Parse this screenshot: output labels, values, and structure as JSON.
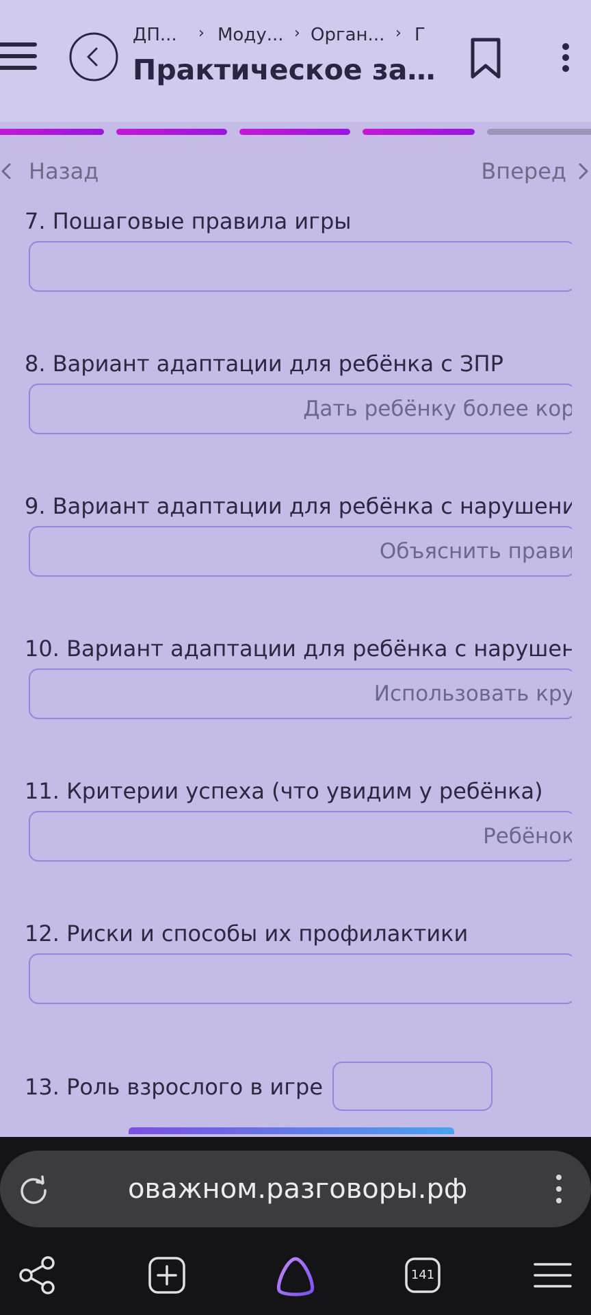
{
  "header": {
    "breadcrumb": [
      "ДП...",
      "Моду...",
      "Орган...",
      "Г"
    ],
    "title": "Практическое задн..."
  },
  "progress": {
    "segments": [
      "done",
      "done",
      "done",
      "done",
      "todo"
    ]
  },
  "nav": {
    "back_label": "Назад",
    "next_label": "Вперед"
  },
  "form": {
    "questions": [
      {
        "label": "7. Пошаговые правила игры",
        "value": ""
      },
      {
        "label": "8. Вариант адаптации для ребёнка с ЗПР",
        "value": "Дать ребёнку более кор"
      },
      {
        "label": "9. Вариант адаптации для ребёнка с нарушени",
        "value": "Объяснить прави"
      },
      {
        "label": "10. Вариант адаптации для ребёнка с нарушен",
        "value": "Использовать кру"
      },
      {
        "label": "11. Критерии успеха (что увидим у ребёнка)",
        "value": "Ребёнок"
      },
      {
        "label": "12. Риски и способы их профилактики",
        "value": ""
      }
    ],
    "q13_label": "13. Роль взрослого в игре",
    "q13_value": ""
  },
  "browser": {
    "url": "оважном.разговоры.рф",
    "tabs_count": "141"
  },
  "colors": {
    "background": "#c4bbe6",
    "header": "#d0cbec",
    "input_border": "#9486dc",
    "progress_done": "#b217da",
    "progress_todo": "#9b96b6"
  }
}
